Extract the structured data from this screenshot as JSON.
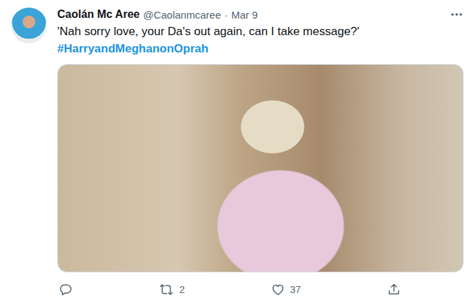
{
  "tweet": {
    "author": {
      "name": "Caolán Mc Aree",
      "handle": "@Caolanmcaree"
    },
    "separator": "·",
    "date": "Mar 9",
    "text": "'Nah sorry love, your Da's out again, can I take message?'",
    "hashtag": "#HarryandMeghanonOprah",
    "actions": [
      {
        "kind": "reply",
        "count": ""
      },
      {
        "kind": "retweet",
        "count": "2"
      },
      {
        "kind": "like",
        "count": "37"
      },
      {
        "kind": "share",
        "count": ""
      }
    ]
  }
}
